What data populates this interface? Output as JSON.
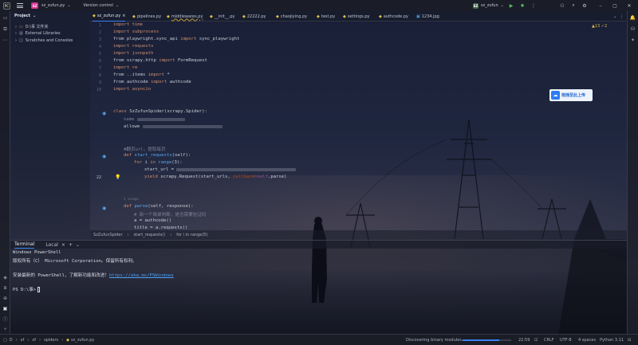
{
  "titlebar": {
    "logo": "PC",
    "project_badge": "SZ",
    "project_name": "sz_zufun.py",
    "vcs": "Version control",
    "run_config": "sz_zufun",
    "run_badge": "SZ"
  },
  "project_panel": {
    "header": "Project",
    "items": [
      {
        "label": "D:\\事 文件夹",
        "icon": "folder-icon"
      },
      {
        "label": "External Libraries",
        "icon": "library-icon"
      },
      {
        "label": "Scratches and Consoles",
        "icon": "scratch-icon"
      }
    ]
  },
  "tabs": [
    {
      "label": "sz_zufun.py",
      "active": true
    },
    {
      "label": "pipelines.py"
    },
    {
      "label": "middlewares.py"
    },
    {
      "label": "__init__.py"
    },
    {
      "label": "22222.py"
    },
    {
      "label": "chaojiying.py"
    },
    {
      "label": "test.py"
    },
    {
      "label": "settings.py"
    },
    {
      "label": "authcode.py"
    },
    {
      "label": "1234.jpg"
    }
  ],
  "editor": {
    "inspection": "▲13 ✓2",
    "usages_hint": "1 usage",
    "current_line": "22",
    "lines": {
      "l1": "import time",
      "l2": "import subprocess",
      "l3a": "from playwright.sync_api ",
      "l3b": "import",
      "l3c": " sync_playwright",
      "l4": "import requests",
      "l5": "import jsonpath",
      "l6a": "from scrapy.http ",
      "l6b": "import",
      "l6c": " FormRequest",
      "l7": "import re",
      "l8a": "from ..items ",
      "l8b": "import",
      "l8c": " *",
      "l9a": "from authcode ",
      "l9b": "import",
      "l9c": " authcode",
      "l10": "import asyncio",
      "class_kw": "class ",
      "class_name": "SzZufunSpider(scrapy.Spider):",
      "name_kw": "name",
      "allowed": "allowe",
      "comment1": "#翻页url，提取每页",
      "def1_kw": "def ",
      "def1_name": "start_requests",
      "def1_args": "(self):",
      "for_kw": "for ",
      "for_rest": "i ",
      "in_kw": "in ",
      "range_fn": "range",
      "range_args": "(3):",
      "start_url": "start_url = ",
      "yield_kw": "yield ",
      "yield_rest": "scrapy.Request(start_urls, ",
      "callback": "callback",
      "eq_self": "=self",
      "parse_rest": ".parse)",
      "def2_name": "parse",
      "def2_args": "(self, response):",
      "comment2": "# 新一个简单判断，是否需要验证码",
      "a_line": "a = authcode()",
      "title_line": "title = a.requests()"
    }
  },
  "breadcrumb": [
    "SzZufunSpider",
    "start_requests()",
    "for i in range(5)"
  ],
  "terminal": {
    "tab_terminal": "Terminal",
    "tab_local": "Local",
    "lines": [
      "Windows PowerShell",
      "版权所有（C） Microsoft Corporation。保留所有权利。",
      "",
      "安装最新的 PowerShell，了解新功能和改进！",
      "PS D:\\事>"
    ],
    "link": "https://aka.ms/PSWindows"
  },
  "status": {
    "path": [
      "D",
      "xf",
      "xf",
      "spiders",
      "sz_zufun.py"
    ],
    "indexing": "Discovering binary modules...",
    "progress": 0.75,
    "position": "22:59",
    "line_sep": "CRLF",
    "encoding": "UTF-8",
    "indent": "4 spaces",
    "python": "Python 3.11"
  },
  "baidu_popup": {
    "label": "拖拽至此上传"
  },
  "colors": {
    "accent": "#3b82f6",
    "project_badge": "#d3358f",
    "keyword": "#cf8e6d"
  }
}
